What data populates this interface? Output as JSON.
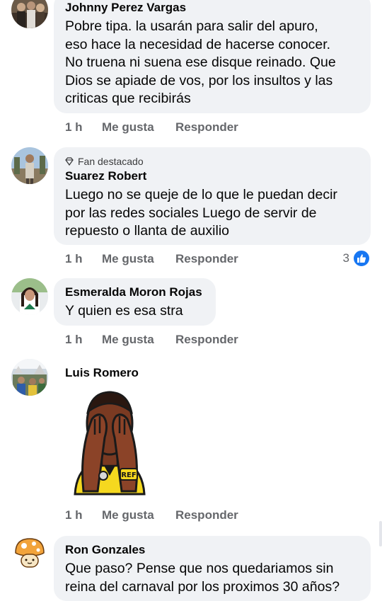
{
  "comments": [
    {
      "name": "Johnny Perez Vargas",
      "lines": [
        "Pobre tipa. la usarán para salir del apuro,",
        "eso hace la necesidad de hacerse conocer.",
        "No truena ni suena ese disque reinado. Que",
        "Dios se apiade de vos, por los insultos y las",
        "criticas que recibirás"
      ],
      "time": "1 h",
      "like": "Me gusta",
      "reply": "Responder"
    },
    {
      "badge": "Fan destacado",
      "name": "Suarez Robert",
      "lines": [
        "Luego no se queje de lo que le puedan decir",
        "por las redes sociales Luego de servir de",
        "repuesto o llanta de auxilio"
      ],
      "time": "1 h",
      "like": "Me gusta",
      "reply": "Responder",
      "reaction_count": "3"
    },
    {
      "name": "Esmeralda Moron Rojas",
      "lines": [
        "Y quien es esa stra"
      ],
      "time": "1 h",
      "like": "Me gusta",
      "reply": "Responder"
    },
    {
      "name": "Luis Romero",
      "sticker_text": "REF",
      "time": "1 h",
      "like": "Me gusta",
      "reply": "Responder"
    },
    {
      "name": "Ron Gonzales",
      "lines": [
        "Que paso? Pense que nos quedariamos sin",
        "reina del carnaval por los proximos 30 años?"
      ]
    }
  ],
  "colors": {
    "bubble": "#f0f2f5",
    "meta_text": "#65676b",
    "like_blue": "#1877f2"
  },
  "icons": [
    "diamond-icon",
    "like-thumb-icon"
  ]
}
